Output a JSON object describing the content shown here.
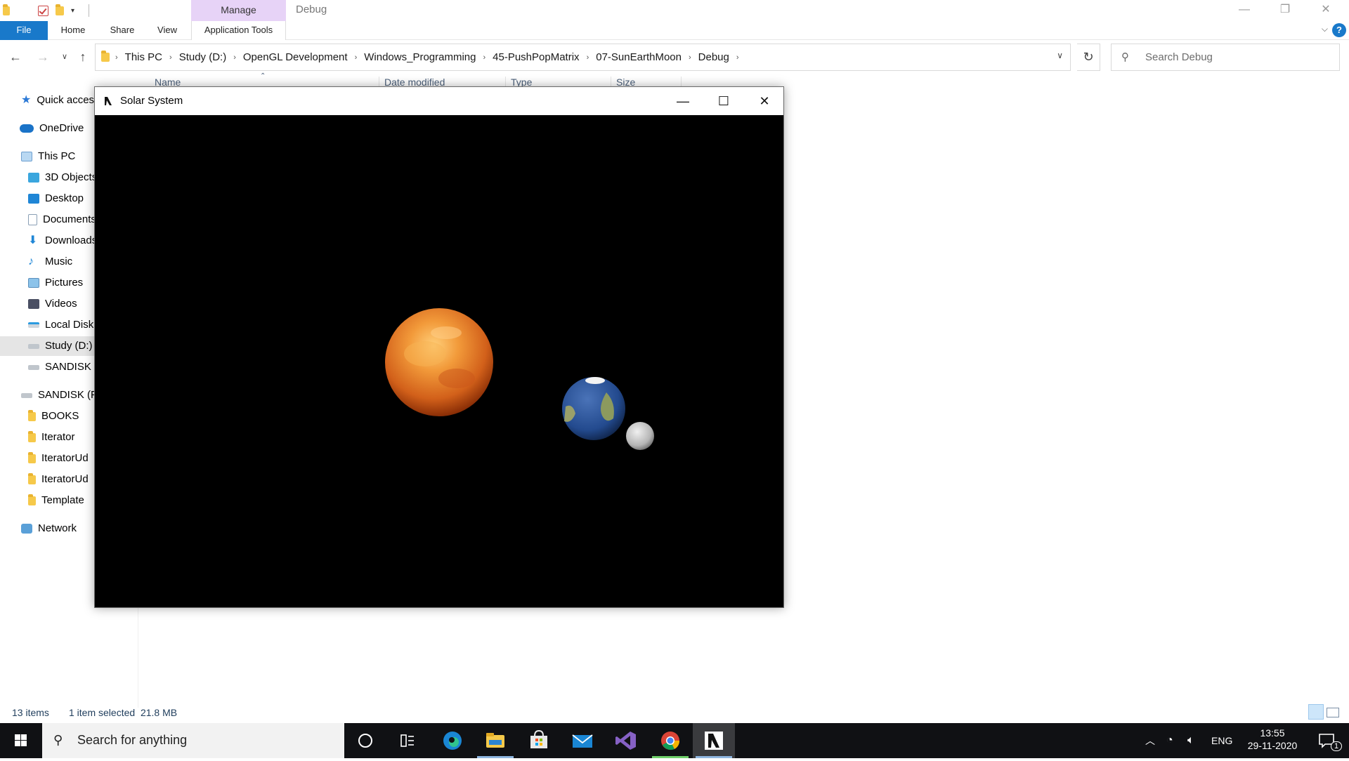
{
  "explorer": {
    "ribbon_context_group": "Manage",
    "window_title": "Debug",
    "tabs": [
      "File",
      "Home",
      "Share",
      "View",
      "Application Tools"
    ],
    "breadcrumbs": [
      "This PC",
      "Study (D:)",
      "OpenGL Development",
      "Windows_Programming",
      "45-PushPopMatrix",
      "07-SunEarthMoon",
      "Debug"
    ],
    "search_placeholder": "Search Debug",
    "columns": [
      "Name",
      "Date modified",
      "Type",
      "Size"
    ],
    "nav_items": [
      {
        "label": "Quick access",
        "icon": "star-icon"
      },
      {
        "label": "OneDrive",
        "icon": "cloud-icon"
      },
      {
        "label": "This PC",
        "icon": "computer-icon"
      },
      {
        "label": "3D Objects",
        "icon": "cube-icon"
      },
      {
        "label": "Desktop",
        "icon": "desktop-icon"
      },
      {
        "label": "Documents",
        "icon": "document-icon"
      },
      {
        "label": "Downloads",
        "icon": "download-icon"
      },
      {
        "label": "Music",
        "icon": "music-icon"
      },
      {
        "label": "Pictures",
        "icon": "pictures-icon"
      },
      {
        "label": "Videos",
        "icon": "videos-icon"
      },
      {
        "label": "Local Disk",
        "icon": "drive-icon"
      },
      {
        "label": "Study (D:)",
        "icon": "drive-icon"
      },
      {
        "label": "SANDISK (",
        "icon": "drive-icon"
      },
      {
        "label": "SANDISK (F:",
        "icon": "drive-icon"
      },
      {
        "label": "BOOKS",
        "icon": "folder-icon"
      },
      {
        "label": "Iterator",
        "icon": "folder-icon"
      },
      {
        "label": "IteratorUd",
        "icon": "folder-icon"
      },
      {
        "label": "IteratorUd",
        "icon": "folder-icon"
      },
      {
        "label": "Template",
        "icon": "folder-icon"
      },
      {
        "label": "Network",
        "icon": "network-icon"
      }
    ],
    "selected_nav": "Study (D:)",
    "status": {
      "items": "13 items",
      "selected": "1 item selected  21.8 MB"
    }
  },
  "gl_window": {
    "title": "Solar System",
    "bodies": {
      "sun": "sun",
      "earth": "earth",
      "moon": "moon"
    }
  },
  "taskbar": {
    "search_placeholder": "Search for anything",
    "apps": [
      "cortana-icon",
      "task-view-icon",
      "edge-icon",
      "file-explorer-icon",
      "store-icon",
      "mail-icon",
      "visual-studio-icon",
      "chrome-icon",
      "opengl-app-icon"
    ],
    "language": "ENG",
    "time": "13:55",
    "date": "29-11-2020",
    "notification_count": "1"
  }
}
